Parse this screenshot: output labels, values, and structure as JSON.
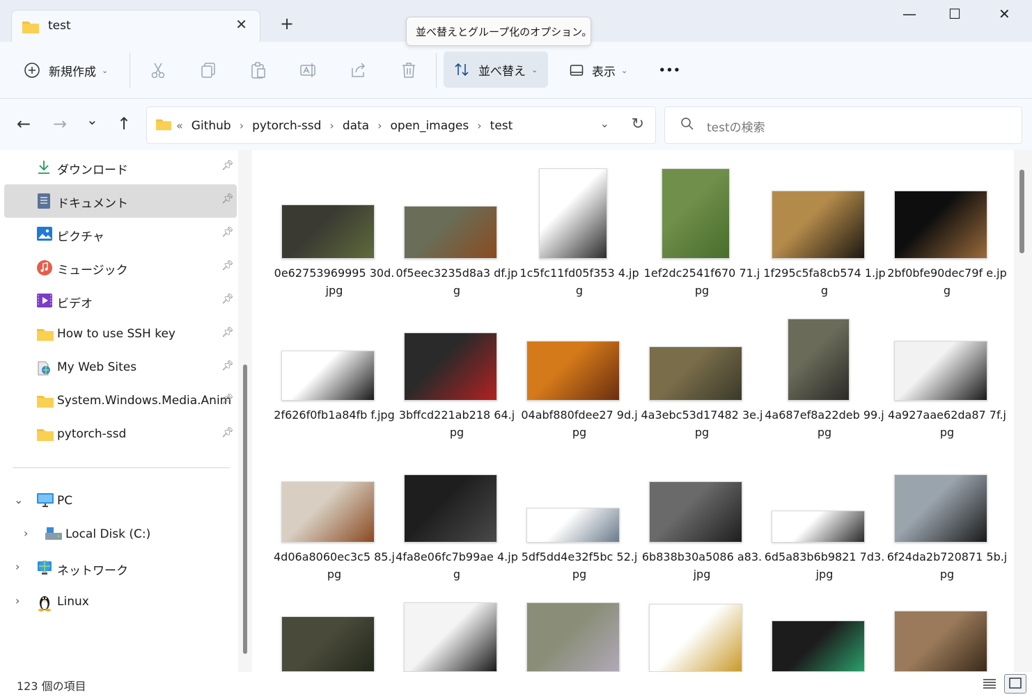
{
  "window": {
    "tab_title": "test",
    "new_tab": "+",
    "tooltip": "並べ替えとグループ化のオプション。",
    "controls": {
      "minimize": "—",
      "maximize": "☐",
      "close": "✕"
    }
  },
  "toolbar": {
    "new_label": "新規作成",
    "sort_label": "並べ替え",
    "view_label": "表示",
    "more_label": "•••"
  },
  "nav": {
    "back": "←",
    "forward": "→",
    "recent": "⌄",
    "up": "↑"
  },
  "address": {
    "overflow": "«",
    "crumbs": [
      "Github",
      "pytorch-ssd",
      "data",
      "open_images",
      "test"
    ],
    "dropdown": "⌄",
    "refresh": "↻"
  },
  "search": {
    "placeholder": "testの検索"
  },
  "sidebar": {
    "quick": [
      {
        "label": "ダウンロード",
        "icon": "download-icon"
      },
      {
        "label": "ドキュメント",
        "icon": "document-icon"
      },
      {
        "label": "ピクチャ",
        "icon": "picture-icon"
      },
      {
        "label": "ミュージック",
        "icon": "music-icon"
      },
      {
        "label": "ビデオ",
        "icon": "video-icon"
      },
      {
        "label": "How to use SSH key",
        "icon": "folder-icon"
      },
      {
        "label": "My Web Sites",
        "icon": "web-folder-icon"
      },
      {
        "label": "System.Windows.Media.Anim",
        "icon": "folder-icon"
      },
      {
        "label": "pytorch-ssd",
        "icon": "folder-icon"
      }
    ],
    "tree": [
      {
        "label": "PC",
        "expand": "⌄"
      },
      {
        "label": "Local Disk (C:)",
        "expand": "›"
      },
      {
        "label": "ネットワーク",
        "expand": "›"
      },
      {
        "label": "Linux",
        "expand": "›"
      }
    ]
  },
  "files": [
    {
      "name": "0e62753969995 30d.jpg",
      "colors": [
        "#3a3a32",
        "#5f6b3c"
      ],
      "h": 78
    },
    {
      "name": "0f5eec3235d8a3 df.jpg",
      "colors": [
        "#6a6d58",
        "#8b4b1f"
      ],
      "h": 76
    },
    {
      "name": "1c5fc11fd05f353 4.jpg",
      "colors": [
        "#ffffff",
        "#2b2b2b"
      ],
      "h": 130
    },
    {
      "name": "1ef2dc2541f670 71.jpg",
      "colors": [
        "#6f8f4a",
        "#486d2d"
      ],
      "h": 130
    },
    {
      "name": "1f295c5fa8cb574 1.jpg",
      "colors": [
        "#b48a4a",
        "#1c1812"
      ],
      "h": 98
    },
    {
      "name": "2bf0bfe90dec79f e.jpg",
      "colors": [
        "#0e0e0e",
        "#9a6a3a"
      ],
      "h": 98
    },
    {
      "name": "2f626f0fb1a84fb f.jpg",
      "colors": [
        "#ffffff",
        "#1a1a1a"
      ],
      "h": 72
    },
    {
      "name": "3bffcd221ab218 64.jpg",
      "colors": [
        "#2a2a2a",
        "#b22222"
      ],
      "h": 98
    },
    {
      "name": "04abf880fdee27 9d.jpg",
      "colors": [
        "#d57a1a",
        "#6a2e10"
      ],
      "h": 86
    },
    {
      "name": "4a3ebc53d17482 3e.jpg",
      "colors": [
        "#7a6d4a",
        "#3a3a2a"
      ],
      "h": 78
    },
    {
      "name": "4a687ef8a22deb 99.jpg",
      "colors": [
        "#6b6b5a",
        "#2c2a26"
      ],
      "h": 118
    },
    {
      "name": "4a927aae62da87 7f.jpg",
      "colors": [
        "#f2f2f2",
        "#1a1a1a"
      ],
      "h": 86
    },
    {
      "name": "4d06a8060ec3c5 85.jpg",
      "colors": [
        "#d8cfc2",
        "#8a4a22"
      ],
      "h": 88
    },
    {
      "name": "4fa8e06fc7b99ae 4.jpg",
      "colors": [
        "#1e1e1e",
        "#4a4a4a"
      ],
      "h": 98
    },
    {
      "name": "5df5dd4e32f5bc 52.jpg",
      "colors": [
        "#ffffff",
        "#6a7a8a"
      ],
      "h": 50
    },
    {
      "name": "6b838b30a5086 a83.jpg",
      "colors": [
        "#6a6a6a",
        "#1e1e1e"
      ],
      "h": 88
    },
    {
      "name": "6d5a83b6b9821 7d3.jpg",
      "colors": [
        "#ffffff",
        "#2a2a2a"
      ],
      "h": 46
    },
    {
      "name": "6f24da2b720871 5b.jpg",
      "colors": [
        "#9aa4ad",
        "#1a1a1a"
      ],
      "h": 98
    }
  ],
  "partial_row": [
    {
      "colors": [
        "#4a4a3a",
        "#22281a"
      ]
    },
    {
      "colors": [
        "#f4f4f4",
        "#1a1a1a"
      ]
    },
    {
      "colors": [
        "#8a8e78",
        "#b0a8b8"
      ]
    },
    {
      "colors": [
        "#ffffff",
        "#c99a2a"
      ]
    },
    {
      "colors": [
        "#1c1c1c",
        "#2aa06a"
      ]
    },
    {
      "colors": [
        "#9a7a5a",
        "#3a2a1a"
      ]
    }
  ],
  "status": {
    "item_count": "123 個の項目"
  },
  "colors": {
    "accent": "#0067c0",
    "folder": "#f3c13a"
  }
}
